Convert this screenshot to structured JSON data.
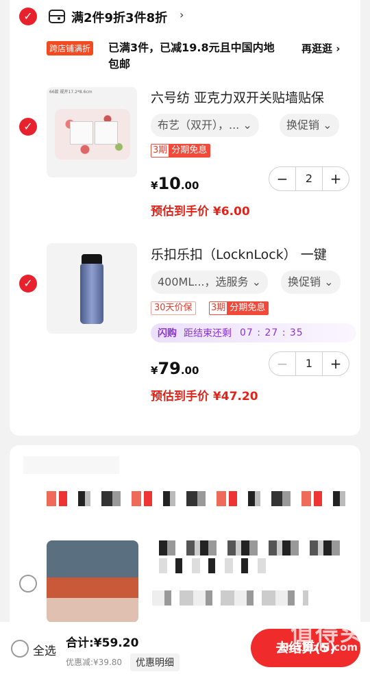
{
  "promo": {
    "title": "满2件9折3件8折",
    "tag": "跨店铺满折",
    "description": "已满3件，已减19.8元且中国内地包邮",
    "link": "再逛逛"
  },
  "items": [
    {
      "title": "六号纺 亚克力双开关贴墙贴保",
      "spec": "布艺（双开），...",
      "promo_option": "换促销",
      "installment_num": "3期",
      "installment_text": "分期免息",
      "price_yen": "¥",
      "price_int": "10",
      "price_dec": ".00",
      "estimate": "预估到手价 ¥6.00",
      "qty": "2",
      "thumb_text": "66款  规开17.2*8.6cm"
    },
    {
      "title": "乐扣乐扣（LocknLock） 一键",
      "spec": "400ML...，选服务",
      "promo_option": "换促销",
      "guarantee": "30天价保",
      "installment_num": "3期",
      "installment_text": "分期免息",
      "flash_label": "闪购",
      "flash_text": "距结束还剩",
      "flash_time": "07 : 27 : 35",
      "price_yen": "¥",
      "price_int": "79",
      "price_dec": ".00",
      "estimate": "预估到手价 ¥47.20",
      "qty": "1"
    }
  ],
  "footer": {
    "select_all": "全选",
    "total": "合计:¥59.20",
    "discount": "优惠减:¥39.80",
    "detail": "优惠明细",
    "checkout": "去结算(5)",
    "watermark": "值得买",
    "watermark_url": "zhizhizhi.com"
  },
  "icons": {
    "check": "checkmark-icon",
    "chevron": "chevron-right-icon",
    "dropdown": "chevron-down-icon",
    "minus": "minus-icon",
    "plus": "plus-icon"
  },
  "colors": {
    "accent": "#e8222c",
    "flash": "#8a31d6"
  }
}
